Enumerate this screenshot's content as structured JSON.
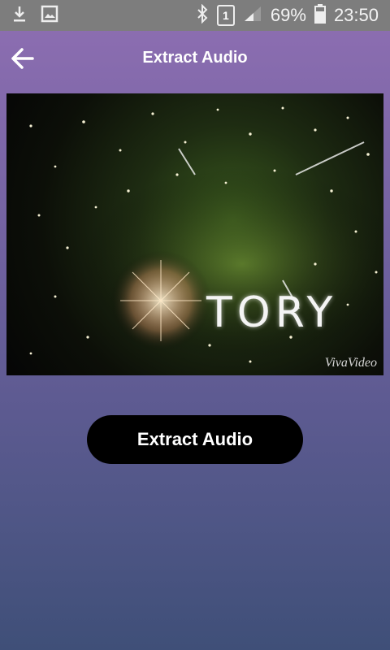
{
  "status_bar": {
    "battery": "69%",
    "time": "23:50",
    "sim_slot": "1",
    "icons": [
      "download-icon",
      "image-icon",
      "bluetooth-icon",
      "sim-icon",
      "signal-icon",
      "battery-icon"
    ]
  },
  "app_bar": {
    "title": "Extract Audio",
    "back_icon": "arrow-left-icon"
  },
  "video": {
    "overlay_text": "TORY",
    "watermark": "VivaVideo"
  },
  "actions": {
    "extract_label": "Extract Audio"
  },
  "colors": {
    "gradient_top": "#8f6fb3",
    "gradient_bottom": "#3f4f78",
    "button_bg": "#000000"
  }
}
